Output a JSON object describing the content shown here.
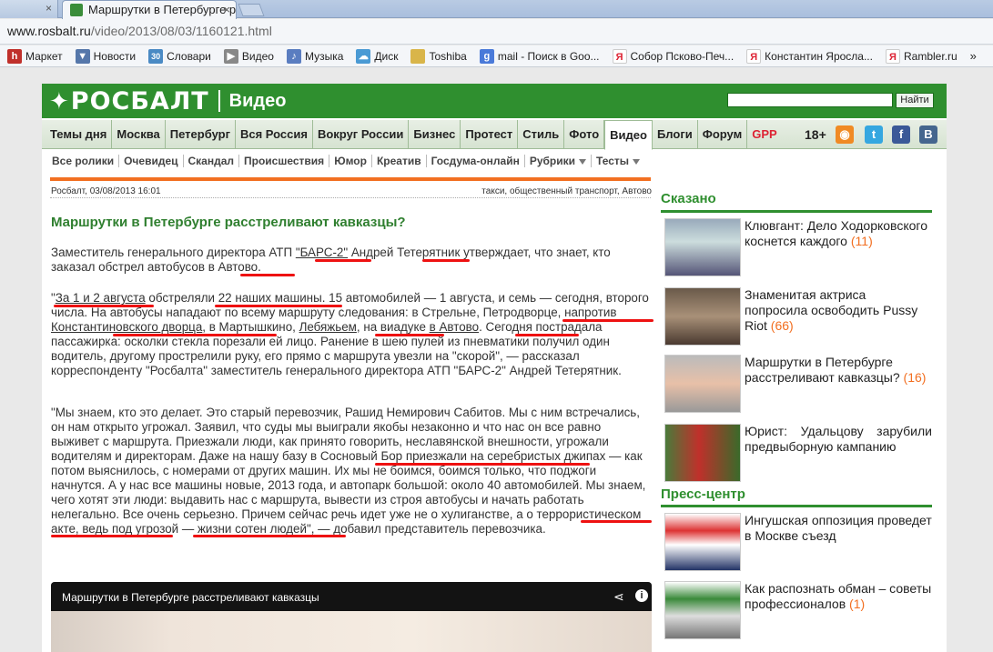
{
  "browser": {
    "prev_tab_label": "",
    "tab_title": "Маршрутки в Петербурге р",
    "url_host": "www.rosbalt.ru",
    "url_path": "/video/2013/08/03/1160121.html",
    "bookmarks": [
      {
        "label": "Маркет",
        "icon": "h-icon",
        "color": "#c0302b"
      },
      {
        "label": "Новости",
        "icon": "news-icon",
        "color": "#5577aa"
      },
      {
        "label": "Словари",
        "icon": "dict-icon",
        "color": "#4a8ac4"
      },
      {
        "label": "Видео",
        "icon": "video-icon",
        "color": "#888"
      },
      {
        "label": "Музыка",
        "icon": "music-icon",
        "color": "#5a7dc0"
      },
      {
        "label": "Диск",
        "icon": "disk-icon",
        "color": "#4a9ad4"
      },
      {
        "label": "Toshiba",
        "icon": "folder-icon",
        "color": "#d9b54a"
      },
      {
        "label": "mail - Поиск в Goo...",
        "icon": "google-icon",
        "color": "#4a7ad9"
      },
      {
        "label": "Собор Псково-Печ...",
        "icon": "yandex-icon",
        "color": "#d23"
      },
      {
        "label": "Константин Яросла...",
        "icon": "yandex-icon",
        "color": "#d23"
      },
      {
        "label": "Rambler.ru",
        "icon": "rambler-icon",
        "color": "#d23"
      }
    ]
  },
  "header": {
    "logo": "РОСБАЛТ",
    "section": "Видео",
    "search_button": "Найти"
  },
  "nav": {
    "items": [
      "Темы дня",
      "Москва",
      "Петербург",
      "Вся Россия",
      "Вокруг России",
      "Бизнес",
      "Протест",
      "Стиль",
      "Фото",
      "Видео",
      "Блоги",
      "Форум",
      "GPP"
    ],
    "active": "Видео",
    "age": "18+"
  },
  "subnav": {
    "items": [
      "Все ролики",
      "Очевидец",
      "Скандал",
      "Происшествия",
      "Юмор",
      "Креатив",
      "Госдума-онлайн",
      "Рубрики",
      "Тесты"
    ]
  },
  "article": {
    "source_date": "Росбалт, 03/08/2013 16:01",
    "tags": "такси, общественный транспорт, Автово",
    "title": "Маршрутки в Петербурге расстреливают кавказцы?",
    "p1_a": "Заместитель генерального директора АТП ",
    "p1_b": "\"БАРС-2\"",
    "p1_c": " Андрей ",
    "p1_d": "Тетерятник",
    "p1_e": " утверждает, что знает, кто заказал обстрел автобусов ",
    "p1_f": "в Автово",
    "p1_g": ".",
    "p2_a": "\"",
    "p2_b": "За 1 и 2 августа",
    "p2_c": " обстреляли 22 наших машины. 15 автомобилей — 1 августа, и семь — сегодня, второго числа. На автобусы нападают по всему маршруту следования: в Стрельне, ",
    "p2_d": "Петродворце",
    "p2_e": ", напротив ",
    "p2_f": "Константиновского дворца",
    "p2_g": ", в Мартышкино, ",
    "p2_h": "Лебяжьем",
    "p2_i": ", на виадуке ",
    "p2_j": "в Автово",
    "p2_k": ". Сегодня пострадала пассажирка: осколки стекла порезали ей лицо. Ранение в шею пулей из пневматики получил один водитель, другому прострелили руку, его прямо с маршрута увезли на \"скорой\", — рассказал корреспонденту \"Росбалта\" заместитель генерального директора АТП \"БАРС-2\" Андрей Тетерятник.",
    "p3": "\"Мы знаем, кто это делает. Это старый перевозчик, Рашид Немирович Сабитов. Мы с ним встречались, он нам открыто угрожал. Заявил, что суды мы выиграли якобы незаконно и что нас он все равно выживет с маршрута. Приезжали люди, как принято говорить, неславянской внешности, угрожали водителям и директорам. Даже на нашу базу в Сосновый Бор приезжали на серебристых джипах — как потом выяснилось, с номерами от других машин. Их мы не боимся, боимся только, что поджоги начнутся. А у нас все машины новые, 2013 года, и автопарк большой: около 40 автомобилей. Мы знаем, чего хотят эти люди: выдавить нас с маршрута, вывести из строя автобусы и начать работать нелегально. Все очень серьезно. Причем сейчас речь идет уже не о хулиганстве, а о террористическом акте, ведь под угрозой — жизни сотен людей\", — добавил представитель перевозчика.",
    "video_title": "Маршрутки в Петербурге расстреливают кавказцы"
  },
  "sidebar": {
    "said_heading": "Сказано",
    "said": [
      {
        "text": "Клювгант: Дело Ходорковского коснется каждого",
        "count": "(11)"
      },
      {
        "text": "Знаменитая актриса попросила освободить Pussy Riot",
        "count": "(66)"
      },
      {
        "text": "Маршрутки в Петербурге расстреливают кавказцы?",
        "count": "(16)"
      },
      {
        "text": "Юрист: Удальцову зарубили предвыборную кампанию",
        "count": ""
      }
    ],
    "press_heading": "Пресс-центр",
    "press": [
      {
        "text": "Ингушская оппозиция проведет в Москве съезд",
        "count": ""
      },
      {
        "text": "Как распознать обман – советы профессионалов",
        "count": "(1)"
      }
    ]
  }
}
